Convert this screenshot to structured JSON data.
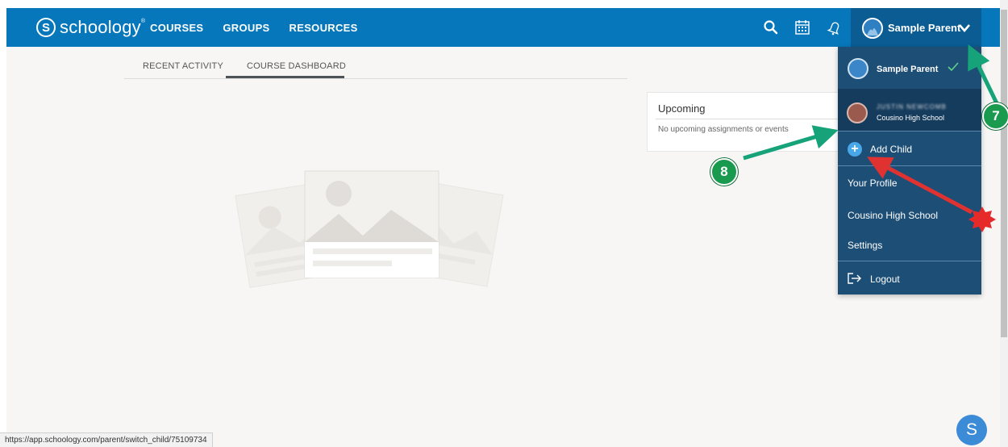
{
  "brand": {
    "name": "schoology",
    "mark": "S",
    "trademark": "®"
  },
  "nav": {
    "courses": "COURSES",
    "groups": "GROUPS",
    "resources": "RESOURCES"
  },
  "header": {
    "user_name": "Sample Parent"
  },
  "tabs": {
    "recent_activity": "RECENT ACTIVITY",
    "course_dashboard": "COURSE DASHBOARD"
  },
  "upcoming": {
    "title": "Upcoming",
    "empty_text": "No upcoming assignments or events"
  },
  "dropdown": {
    "current_user": "Sample Parent",
    "child": {
      "name": "JUSTIN NEWCOMB",
      "school": "Cousino High School"
    },
    "add_child": "Add Child",
    "your_profile": "Your Profile",
    "school": "Cousino High School",
    "settings": "Settings",
    "logout": "Logout"
  },
  "status_bar": {
    "url": "https://app.schoology.com/parent/switch_child/75109734"
  },
  "floating": {
    "label": "S"
  },
  "annotations": {
    "badge_7": "7",
    "badge_8": "8"
  },
  "colors": {
    "header": "#0677ba",
    "dropdown": "#1d4e76",
    "badge": "#1a9a4f",
    "annotation_arrow": "#e13232",
    "teal_arrow": "#16a37a"
  },
  "icons": [
    "search-icon",
    "calendar-icon",
    "bell-icon",
    "chevron-down-icon",
    "check-icon",
    "plus-circle-icon",
    "logout-icon",
    "star-burst-icon"
  ]
}
